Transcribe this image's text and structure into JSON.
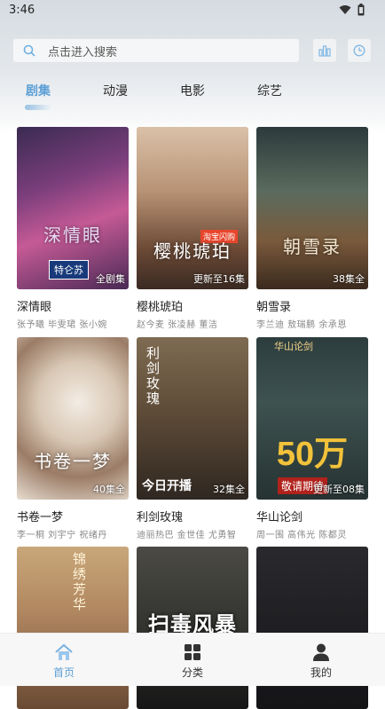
{
  "status_bar": {
    "time": "3:46",
    "icons": [
      "wifi-icon",
      "battery-icon"
    ]
  },
  "search": {
    "placeholder": "点击进入搜索",
    "icon": "search-icon"
  },
  "header_buttons": [
    "stats-icon",
    "history-clock-icon"
  ],
  "tabs": [
    {
      "label": "剧集",
      "active": true
    },
    {
      "label": "动漫",
      "active": false
    },
    {
      "label": "电影",
      "active": false
    },
    {
      "label": "综艺",
      "active": false
    }
  ],
  "items": [
    {
      "title": "深情眼",
      "cast": "张予曦  毕雯珺  张小婉",
      "badge": "全剧集",
      "poster_text": "深情眼",
      "poster_extra": "特仑苏"
    },
    {
      "title": "樱桃琥珀",
      "cast": "赵今麦  张凌赫  董洁",
      "badge": "更新至16集",
      "poster_text": "樱桃琥珀",
      "poster_extra": "淘宝闪购"
    },
    {
      "title": "朝雪录",
      "cast": "李兰迪  敖瑞鹏  余承恩",
      "badge": "38集全",
      "poster_text": "朝雪录"
    },
    {
      "title": "书卷一梦",
      "cast": "李一桐  刘宇宁  祝绪丹",
      "badge": "40集全",
      "poster_text": "书卷一梦"
    },
    {
      "title": "利剑玫瑰",
      "cast": "迪丽热巴  金世佳  尤勇智",
      "badge": "32集全",
      "poster_text": "利剑玫瑰",
      "poster_extra": "今日开播"
    },
    {
      "title": "华山论剑",
      "cast": "周一围  高伟光  陈都灵",
      "badge": "更新至08集",
      "poster_text": "50万",
      "poster_extra": "敬请期待",
      "poster_top": "华山论剑"
    },
    {
      "title": "",
      "cast": "",
      "badge": "",
      "poster_text": "锦绣芳华"
    },
    {
      "title": "",
      "cast": "",
      "badge": "",
      "poster_text": "扫毒风暴"
    },
    {
      "title": "",
      "cast": "",
      "badge": "",
      "poster_text": ""
    }
  ],
  "bottom_nav": [
    {
      "label": "首页",
      "icon": "home-icon",
      "active": true
    },
    {
      "label": "分类",
      "icon": "grid-icon",
      "active": false
    },
    {
      "label": "我的",
      "icon": "user-icon",
      "active": false
    }
  ],
  "colors": {
    "accent": "#5da0d6",
    "text": "#222222",
    "subtext": "#888888"
  }
}
